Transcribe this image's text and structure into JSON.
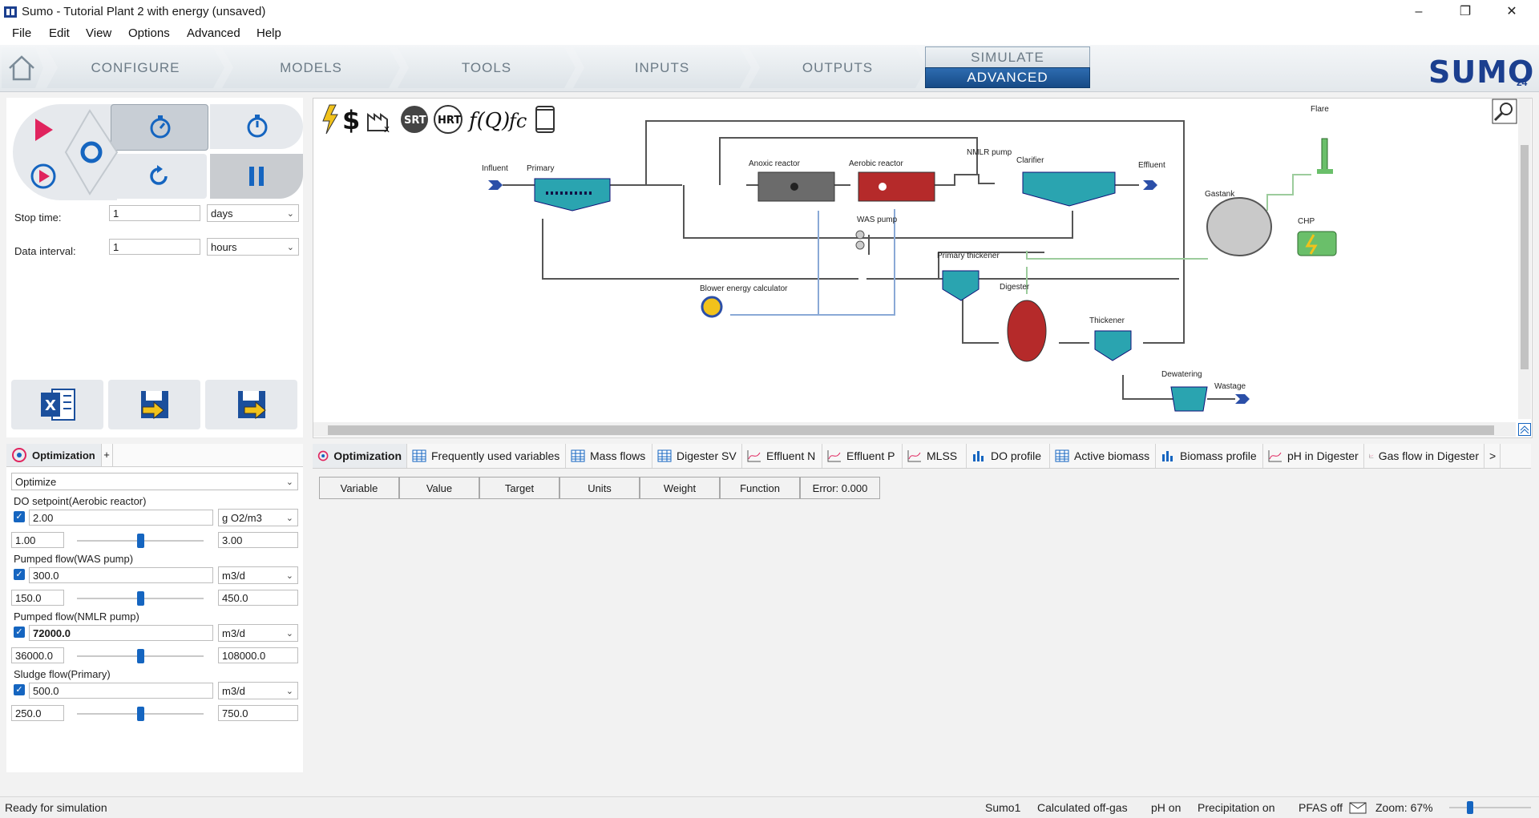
{
  "window": {
    "title": "Sumo - Tutorial Plant 2 with energy (unsaved)",
    "minimize": "–",
    "restore": "❐",
    "close": "✕"
  },
  "menu": [
    "File",
    "Edit",
    "View",
    "Options",
    "Advanced",
    "Help"
  ],
  "ribbon": {
    "tabs": [
      "CONFIGURE",
      "MODELS",
      "TOOLS",
      "INPUTS",
      "OUTPUTS"
    ],
    "simulate": "SIMULATE",
    "advanced": "ADVANCED",
    "logo": "SUMO",
    "logo_version": "24"
  },
  "controls": {
    "stop_time_label": "Stop time:",
    "stop_time_value": "1",
    "stop_time_unit": "days",
    "data_interval_label": "Data interval:",
    "data_interval_value": "1",
    "data_interval_unit": "hours"
  },
  "diagram": {
    "labels": {
      "influent": "Influent",
      "primary": "Primary",
      "anoxic": "Anoxic reactor",
      "aerobic": "Aerobic reactor",
      "nmlr": "NMLR pump",
      "clarifier": "Clarifier",
      "effluent": "Effluent",
      "flare": "Flare",
      "gastank": "Gastank",
      "chp": "CHP",
      "was": "WAS pump",
      "primary_thickener": "Primary thickener",
      "digester": "Digester",
      "thickener": "Thickener",
      "blower": "Blower energy calculator",
      "dewatering": "Dewatering",
      "wastage": "Wastage"
    },
    "toolbar": [
      "lightning-icon",
      "dollar-icon",
      "factory-icon",
      "SRT",
      "HRT",
      "fQ",
      "fc",
      "scroll-icon"
    ]
  },
  "optimization": {
    "tab_label": "Optimization",
    "add_tab": "+",
    "mode": "Optimize",
    "params": [
      {
        "label": "DO setpoint(Aerobic reactor)",
        "value": "2.00",
        "unit": "g O2/m3",
        "min": "1.00",
        "max": "3.00",
        "bold": false,
        "level": 0.5
      },
      {
        "label": "Pumped flow(WAS pump)",
        "value": "300.0",
        "unit": "m3/d",
        "min": "150.0",
        "max": "450.0",
        "bold": false,
        "level": 0.5
      },
      {
        "label": "Pumped flow(NMLR pump)",
        "value": "72000.0",
        "unit": "m3/d",
        "min": "36000.0",
        "max": "108000.0",
        "bold": true,
        "level": 0.5
      },
      {
        "label": "Sludge flow(Primary)",
        "value": "500.0",
        "unit": "m3/d",
        "min": "250.0",
        "max": "750.0",
        "bold": false,
        "level": 0.5
      }
    ]
  },
  "bottom_tabs": [
    "Optimization",
    "Frequently used variables",
    "Mass flows",
    "Digester SV",
    "Effluent N",
    "Effluent P",
    "MLSS",
    "DO profile",
    "Active biomass",
    "Biomass profile",
    "pH in Digester",
    "Gas flow in Digester",
    ">"
  ],
  "table_headers": [
    "Variable",
    "Value",
    "Target",
    "Units",
    "Weight",
    "Function",
    "Error: 0.000"
  ],
  "status": {
    "left": "Ready for simulation",
    "sumo": "Sumo1",
    "offgas": "Calculated off-gas",
    "ph": "pH on",
    "precip": "Precipitation on",
    "pfas": "PFAS off",
    "zoom": "Zoom: 67%"
  },
  "colors": {
    "accent": "#1565c0",
    "play": "#e0245e",
    "teal": "#1a9aa8",
    "aerobic": "#b52a2a"
  }
}
